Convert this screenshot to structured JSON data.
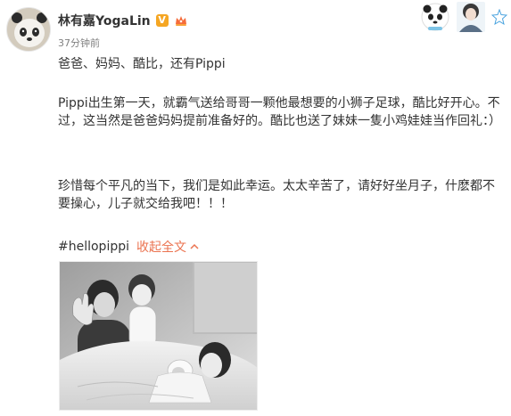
{
  "post": {
    "author": {
      "name": "林有嘉YogaLin",
      "verified_badge": "V",
      "avatar_icon": "panda-icon"
    },
    "timestamp": "37分钟前",
    "paragraphs": [
      "爸爸、妈妈、酷比，还有Pippi",
      "Pippi出生第一天，就霸气送给哥哥一颗他最想要的小狮子足球，酷比好开心。不过，这当然是爸爸妈妈提前准备好的。酷比也送了妹妹一隻小鸡娃娃当作回礼：）",
      "珍惜每个平凡的当下，我们是如此幸运。太太辛苦了，请好好坐月子，什麽都不要操心，儿子就交给我吧！！！"
    ],
    "hashtag": "#hellopippi",
    "collapse_label": "收起全文",
    "collapse_icon": "chevron-up-icon",
    "photo_alt": "family-photo"
  },
  "header_widget": {
    "icons": [
      "panda-sticker-icon",
      "portrait-icon",
      "star-icon"
    ]
  },
  "colors": {
    "accent": "#eb7350",
    "badge": "#f5a623",
    "text": "#333333",
    "muted": "#808080"
  }
}
